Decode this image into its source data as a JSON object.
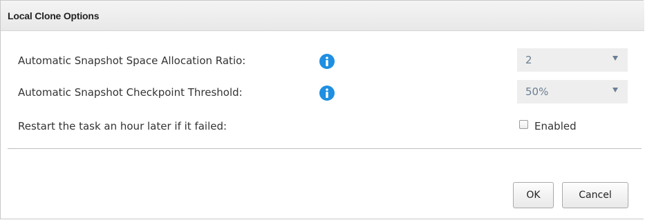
{
  "dialog": {
    "title": "Local Clone Options"
  },
  "settings": {
    "space_ratio": {
      "label": "Automatic Snapshot Space Allocation Ratio:",
      "info_icon": "info-icon",
      "value": "2"
    },
    "checkpoint_threshold": {
      "label": "Automatic Snapshot Checkpoint Threshold:",
      "info_icon": "info-icon",
      "value": "50%"
    },
    "restart_task": {
      "label": "Restart the task an hour later if it failed:",
      "checkbox_label": "Enabled",
      "checked": false
    }
  },
  "buttons": {
    "ok": "OK",
    "cancel": "Cancel"
  },
  "colors": {
    "info_icon": "#1e8fe1",
    "select_bg": "#eeeeee",
    "select_text": "#6a7f93"
  }
}
